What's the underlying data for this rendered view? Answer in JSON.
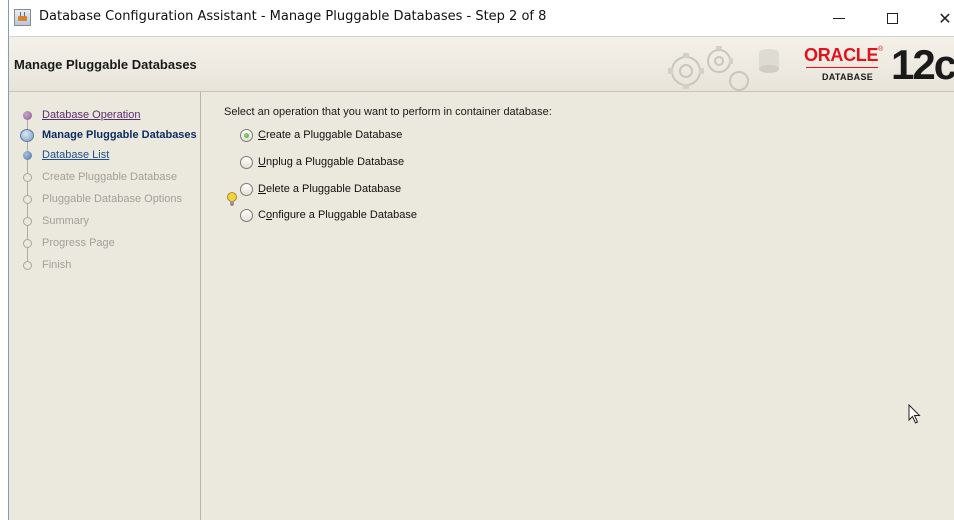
{
  "window": {
    "title": "Database Configuration Assistant - Manage Pluggable Databases - Step 2 of 8",
    "controls": {
      "minimize": "minimize-icon",
      "maximize": "maximize-icon",
      "close": "close-icon",
      "close_glyph": "✕"
    }
  },
  "header": {
    "page_title": "Manage Pluggable Databases",
    "logo_word": "ORACLE",
    "logo_reg": "®",
    "logo_sub": "DATABASE",
    "version": "12c"
  },
  "steps": [
    {
      "label": "Database Operation",
      "state": "done"
    },
    {
      "label": "Manage Pluggable Databases",
      "state": "current"
    },
    {
      "label": "Database List",
      "state": "link"
    },
    {
      "label": "Create Pluggable Database",
      "state": "future"
    },
    {
      "label": "Pluggable Database Options",
      "state": "future"
    },
    {
      "label": "Summary",
      "state": "future"
    },
    {
      "label": "Progress Page",
      "state": "future"
    },
    {
      "label": "Finish",
      "state": "future"
    }
  ],
  "main": {
    "instruction": "Select an operation that you want to perform in container database:",
    "options": [
      {
        "mnemonic": "C",
        "rest": "reate a Pluggable Database",
        "checked": true
      },
      {
        "mnemonic": "U",
        "rest": "nplug a Pluggable Database",
        "checked": false
      },
      {
        "mnemonic": "D",
        "rest": "elete a Pluggable Database",
        "checked": false
      },
      {
        "prefix": "C",
        "mnemonic": "o",
        "rest": "nfigure a Pluggable Database",
        "checked": false
      }
    ]
  },
  "colors": {
    "oracle_red": "#e0141e",
    "panel_bg": "#ebe8de",
    "radio_selected": "#2e9a24"
  }
}
